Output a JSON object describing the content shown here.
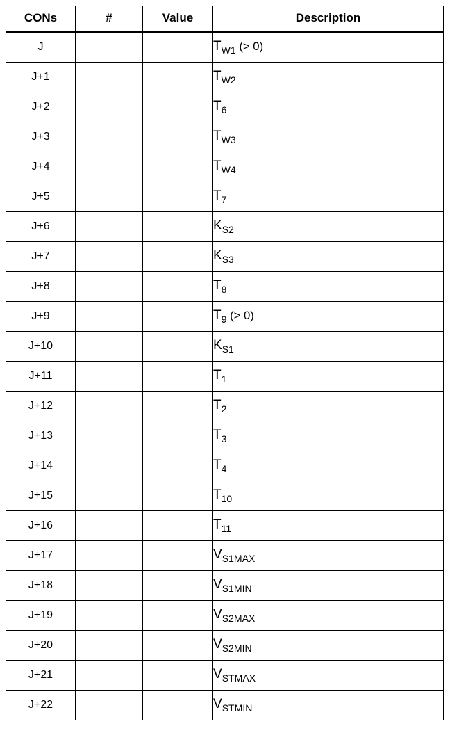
{
  "table": {
    "columns": [
      {
        "key": "cons",
        "label": "CONs"
      },
      {
        "key": "num",
        "label": "#"
      },
      {
        "key": "value",
        "label": "Value"
      },
      {
        "key": "desc",
        "label": "Description"
      }
    ],
    "rows": [
      {
        "cons": "J",
        "num": "",
        "value": "",
        "desc_base": "T",
        "desc_sub": "W1",
        "desc_tail": " (> 0)",
        "desc_text": "TW1 (> 0)"
      },
      {
        "cons": "J+1",
        "num": "",
        "value": "",
        "desc_base": "T",
        "desc_sub": "W2",
        "desc_tail": "",
        "desc_text": "TW2"
      },
      {
        "cons": "J+2",
        "num": "",
        "value": "",
        "desc_base": "T",
        "desc_sub": "6",
        "desc_tail": "",
        "desc_text": "T6"
      },
      {
        "cons": "J+3",
        "num": "",
        "value": "",
        "desc_base": "T",
        "desc_sub": "W3",
        "desc_tail": "",
        "desc_text": "TW3"
      },
      {
        "cons": "J+4",
        "num": "",
        "value": "",
        "desc_base": "T",
        "desc_sub": "W4",
        "desc_tail": "",
        "desc_text": "TW4"
      },
      {
        "cons": "J+5",
        "num": "",
        "value": "",
        "desc_base": "T",
        "desc_sub": "7",
        "desc_tail": "",
        "desc_text": "T7"
      },
      {
        "cons": "J+6",
        "num": "",
        "value": "",
        "desc_base": "K",
        "desc_sub": "S2",
        "desc_tail": "",
        "desc_text": "KS2"
      },
      {
        "cons": "J+7",
        "num": "",
        "value": "",
        "desc_base": "K",
        "desc_sub": "S3",
        "desc_tail": "",
        "desc_text": "KS3"
      },
      {
        "cons": "J+8",
        "num": "",
        "value": "",
        "desc_base": "T",
        "desc_sub": "8",
        "desc_tail": "",
        "desc_text": "T8"
      },
      {
        "cons": "J+9",
        "num": "",
        "value": "",
        "desc_base": "T",
        "desc_sub": "9",
        "desc_tail": " (> 0)",
        "desc_text": "T9 (> 0)"
      },
      {
        "cons": "J+10",
        "num": "",
        "value": "",
        "desc_base": "K",
        "desc_sub": "S1",
        "desc_tail": "",
        "desc_text": "KS1"
      },
      {
        "cons": "J+11",
        "num": "",
        "value": "",
        "desc_base": "T",
        "desc_sub": "1",
        "desc_tail": "",
        "desc_text": "T1"
      },
      {
        "cons": "J+12",
        "num": "",
        "value": "",
        "desc_base": "T",
        "desc_sub": "2",
        "desc_tail": "",
        "desc_text": "T2"
      },
      {
        "cons": "J+13",
        "num": "",
        "value": "",
        "desc_base": "T",
        "desc_sub": "3",
        "desc_tail": "",
        "desc_text": "T3"
      },
      {
        "cons": "J+14",
        "num": "",
        "value": "",
        "desc_base": "T",
        "desc_sub": "4",
        "desc_tail": "",
        "desc_text": "T4"
      },
      {
        "cons": "J+15",
        "num": "",
        "value": "",
        "desc_base": "T",
        "desc_sub": "10",
        "desc_tail": "",
        "desc_text": "T10"
      },
      {
        "cons": "J+16",
        "num": "",
        "value": "",
        "desc_base": "T",
        "desc_sub": "11",
        "desc_tail": "",
        "desc_text": "T11"
      },
      {
        "cons": "J+17",
        "num": "",
        "value": "",
        "desc_base": "V",
        "desc_sub": "S1MAX",
        "desc_tail": "",
        "desc_text": "VS1MAX"
      },
      {
        "cons": "J+18",
        "num": "",
        "value": "",
        "desc_base": "V",
        "desc_sub": "S1MIN",
        "desc_tail": "",
        "desc_text": "VS1MIN"
      },
      {
        "cons": "J+19",
        "num": "",
        "value": "",
        "desc_base": "V",
        "desc_sub": "S2MAX",
        "desc_tail": "",
        "desc_text": "VS2MAX"
      },
      {
        "cons": "J+20",
        "num": "",
        "value": "",
        "desc_base": "V",
        "desc_sub": "S2MIN",
        "desc_tail": "",
        "desc_text": "VS2MIN"
      },
      {
        "cons": "J+21",
        "num": "",
        "value": "",
        "desc_base": "V",
        "desc_sub": "STMAX",
        "desc_tail": "",
        "desc_text": "VSTMAX"
      },
      {
        "cons": "J+22",
        "num": "",
        "value": "",
        "desc_base": "V",
        "desc_sub": "STMIN",
        "desc_tail": "",
        "desc_text": "VSTMIN"
      }
    ]
  },
  "style": {
    "text_color": "#000000",
    "border_color": "#000000",
    "background": "#ffffff"
  }
}
